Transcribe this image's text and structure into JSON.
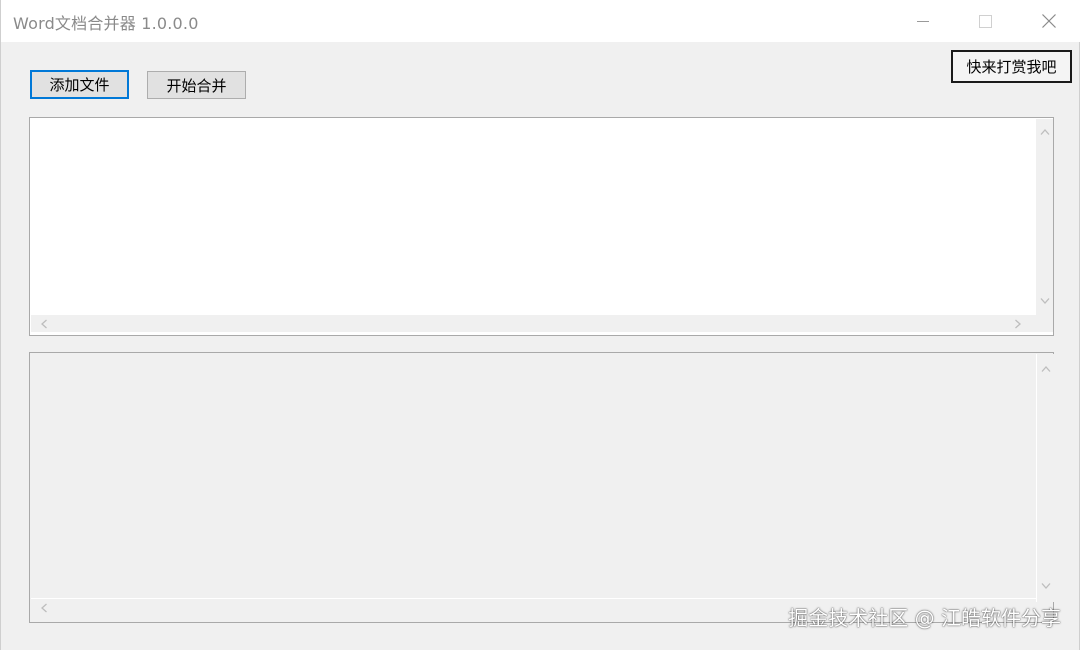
{
  "window": {
    "title": "Word文档合并器 1.0.0.0"
  },
  "toolbar": {
    "add_files_label": "添加文件",
    "start_merge_label": "开始合并",
    "reward_label": "快来打赏我吧"
  },
  "file_list": {
    "items": []
  },
  "log_output": {
    "text": ""
  },
  "watermark": {
    "text": "掘金技术社区 @ 江皓软件分享"
  },
  "colors": {
    "focus_border": "#0078d7",
    "window_bg": "#f0f0f0",
    "list_bg": "#ffffff"
  }
}
